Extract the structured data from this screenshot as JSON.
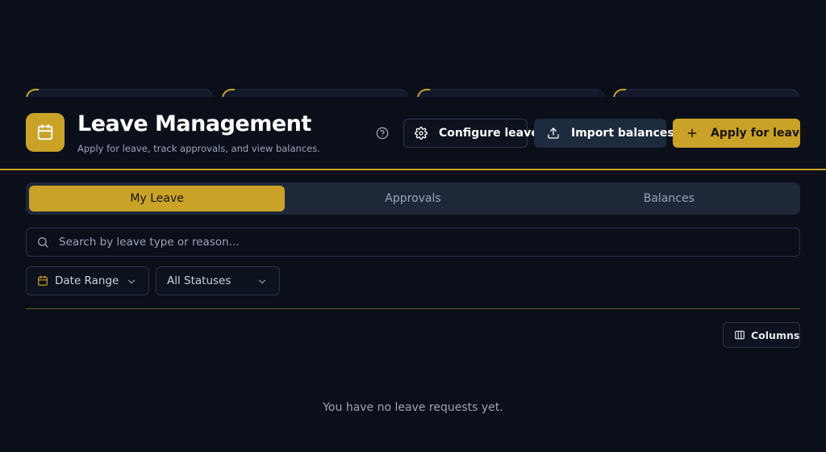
{
  "header": {
    "title": "Leave Management",
    "subtitle": "Apply for leave, track approvals, and view balances.",
    "app_icon": "calendar-icon",
    "help_icon": "help-circle-icon",
    "buttons": {
      "configure": "Configure leave",
      "import": "Import balances",
      "apply": "Apply for leave"
    }
  },
  "tabs": [
    {
      "label": "My Leave",
      "active": true
    },
    {
      "label": "Approvals",
      "active": false
    },
    {
      "label": "Balances",
      "active": false
    }
  ],
  "search": {
    "placeholder": "Search by leave type or reason...",
    "value": ""
  },
  "filters": {
    "date_range": "Date Range",
    "status": "All Statuses"
  },
  "toolbar": {
    "columns_label": "Columns"
  },
  "empty_state": "You have no leave requests yet.",
  "colors": {
    "background": "#0b0f1a",
    "accent": "#c9a227",
    "surface": "#1e2839"
  }
}
